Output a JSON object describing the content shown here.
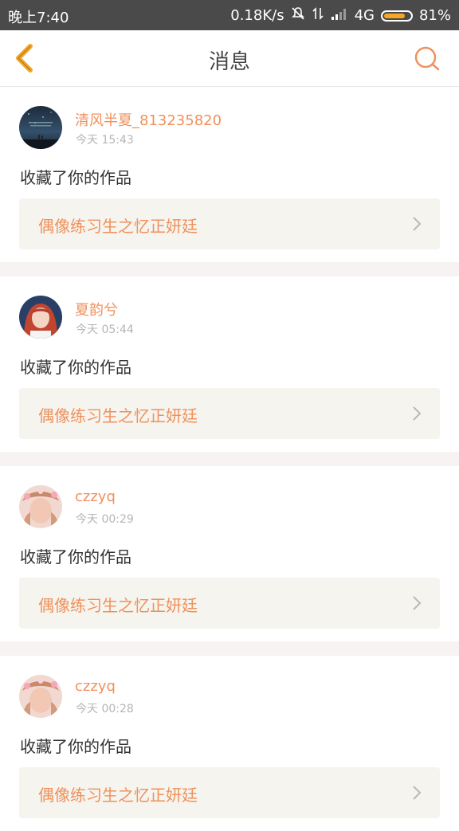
{
  "status_bar": {
    "time": "晚上7:40",
    "network_speed": "0.18K/s",
    "network_type": "4G",
    "battery_percent": "81%",
    "battery_level": 0.81,
    "icons": [
      "mute-icon",
      "data-transfer-icon",
      "signal-icon",
      "battery-icon"
    ]
  },
  "header": {
    "title": "消息",
    "back_icon": "chevron-left-icon",
    "search_icon": "search-icon",
    "accent_color": "#f5a623"
  },
  "messages": [
    {
      "username": "清风半夏_813235820",
      "time": "今天 15:43",
      "action": "收藏了你的作品",
      "work_title": "偶像练习生之忆正妍廷",
      "avatar_style": "night-sky"
    },
    {
      "username": "夏韵兮",
      "time": "今天 05:44",
      "action": "收藏了你的作品",
      "work_title": "偶像练习生之忆正妍廷",
      "avatar_style": "portrait-red"
    },
    {
      "username": "czzyq",
      "time": "今天 00:29",
      "action": "收藏了你的作品",
      "work_title": "偶像练习生之忆正妍廷",
      "avatar_style": "portrait-flowers"
    },
    {
      "username": "czzyq",
      "time": "今天 00:28",
      "action": "收藏了你的作品",
      "work_title": "偶像练习生之忆正妍廷",
      "avatar_style": "portrait-flowers"
    }
  ],
  "colors": {
    "username": "#f0915c",
    "work_title": "#f0915c",
    "work_box_bg": "#f5f4ee",
    "separator": "#f6f3f2"
  }
}
